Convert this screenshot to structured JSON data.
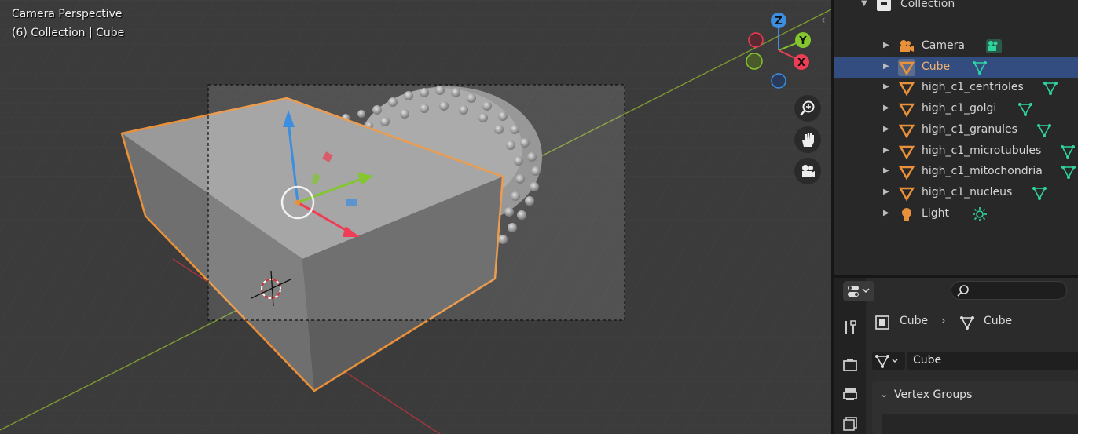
{
  "viewport": {
    "info_line1": "Camera Perspective",
    "info_line2": "(6) Collection | Cube",
    "gizmo_axes": {
      "z": "Z",
      "y": "Y",
      "x": "X"
    },
    "nav_buttons": [
      "zoom-icon",
      "hand-icon",
      "camera-icon"
    ]
  },
  "outliner": {
    "collection_label": "Collection",
    "items": [
      {
        "label": "Camera",
        "icon": "camera-icon",
        "data_icon": "camera-data-icon"
      },
      {
        "label": "Cube",
        "icon": "mesh-object-icon",
        "data_icon": "mesh-data-icon",
        "selected": true
      },
      {
        "label": "high_c1_centrioles",
        "icon": "mesh-object-icon",
        "data_icon": "mesh-data-icon"
      },
      {
        "label": "high_c1_golgi",
        "icon": "mesh-object-icon",
        "data_icon": "mesh-data-icon"
      },
      {
        "label": "high_c1_granules",
        "icon": "mesh-object-icon",
        "data_icon": "mesh-data-icon"
      },
      {
        "label": "high_c1_microtubules",
        "icon": "mesh-object-icon",
        "data_icon": "mesh-data-icon"
      },
      {
        "label": "high_c1_mitochondria",
        "icon": "mesh-object-icon",
        "data_icon": "mesh-data-icon"
      },
      {
        "label": "high_c1_nucleus",
        "icon": "mesh-object-icon",
        "data_icon": "mesh-data-icon"
      },
      {
        "label": "Light",
        "icon": "light-icon",
        "data_icon": "sun-icon"
      }
    ]
  },
  "properties": {
    "breadcrumb_object": "Cube",
    "breadcrumb_mesh": "Cube",
    "mesh_name": "Cube",
    "panel_title": "Vertex Groups"
  },
  "colors": {
    "accent_orange": "#e8903a",
    "selection_blue": "#334d80",
    "mesh_green": "#2fd4a0",
    "axis_x": "#ee3d54",
    "axis_y": "#83c630",
    "axis_z": "#3d8ee0"
  }
}
